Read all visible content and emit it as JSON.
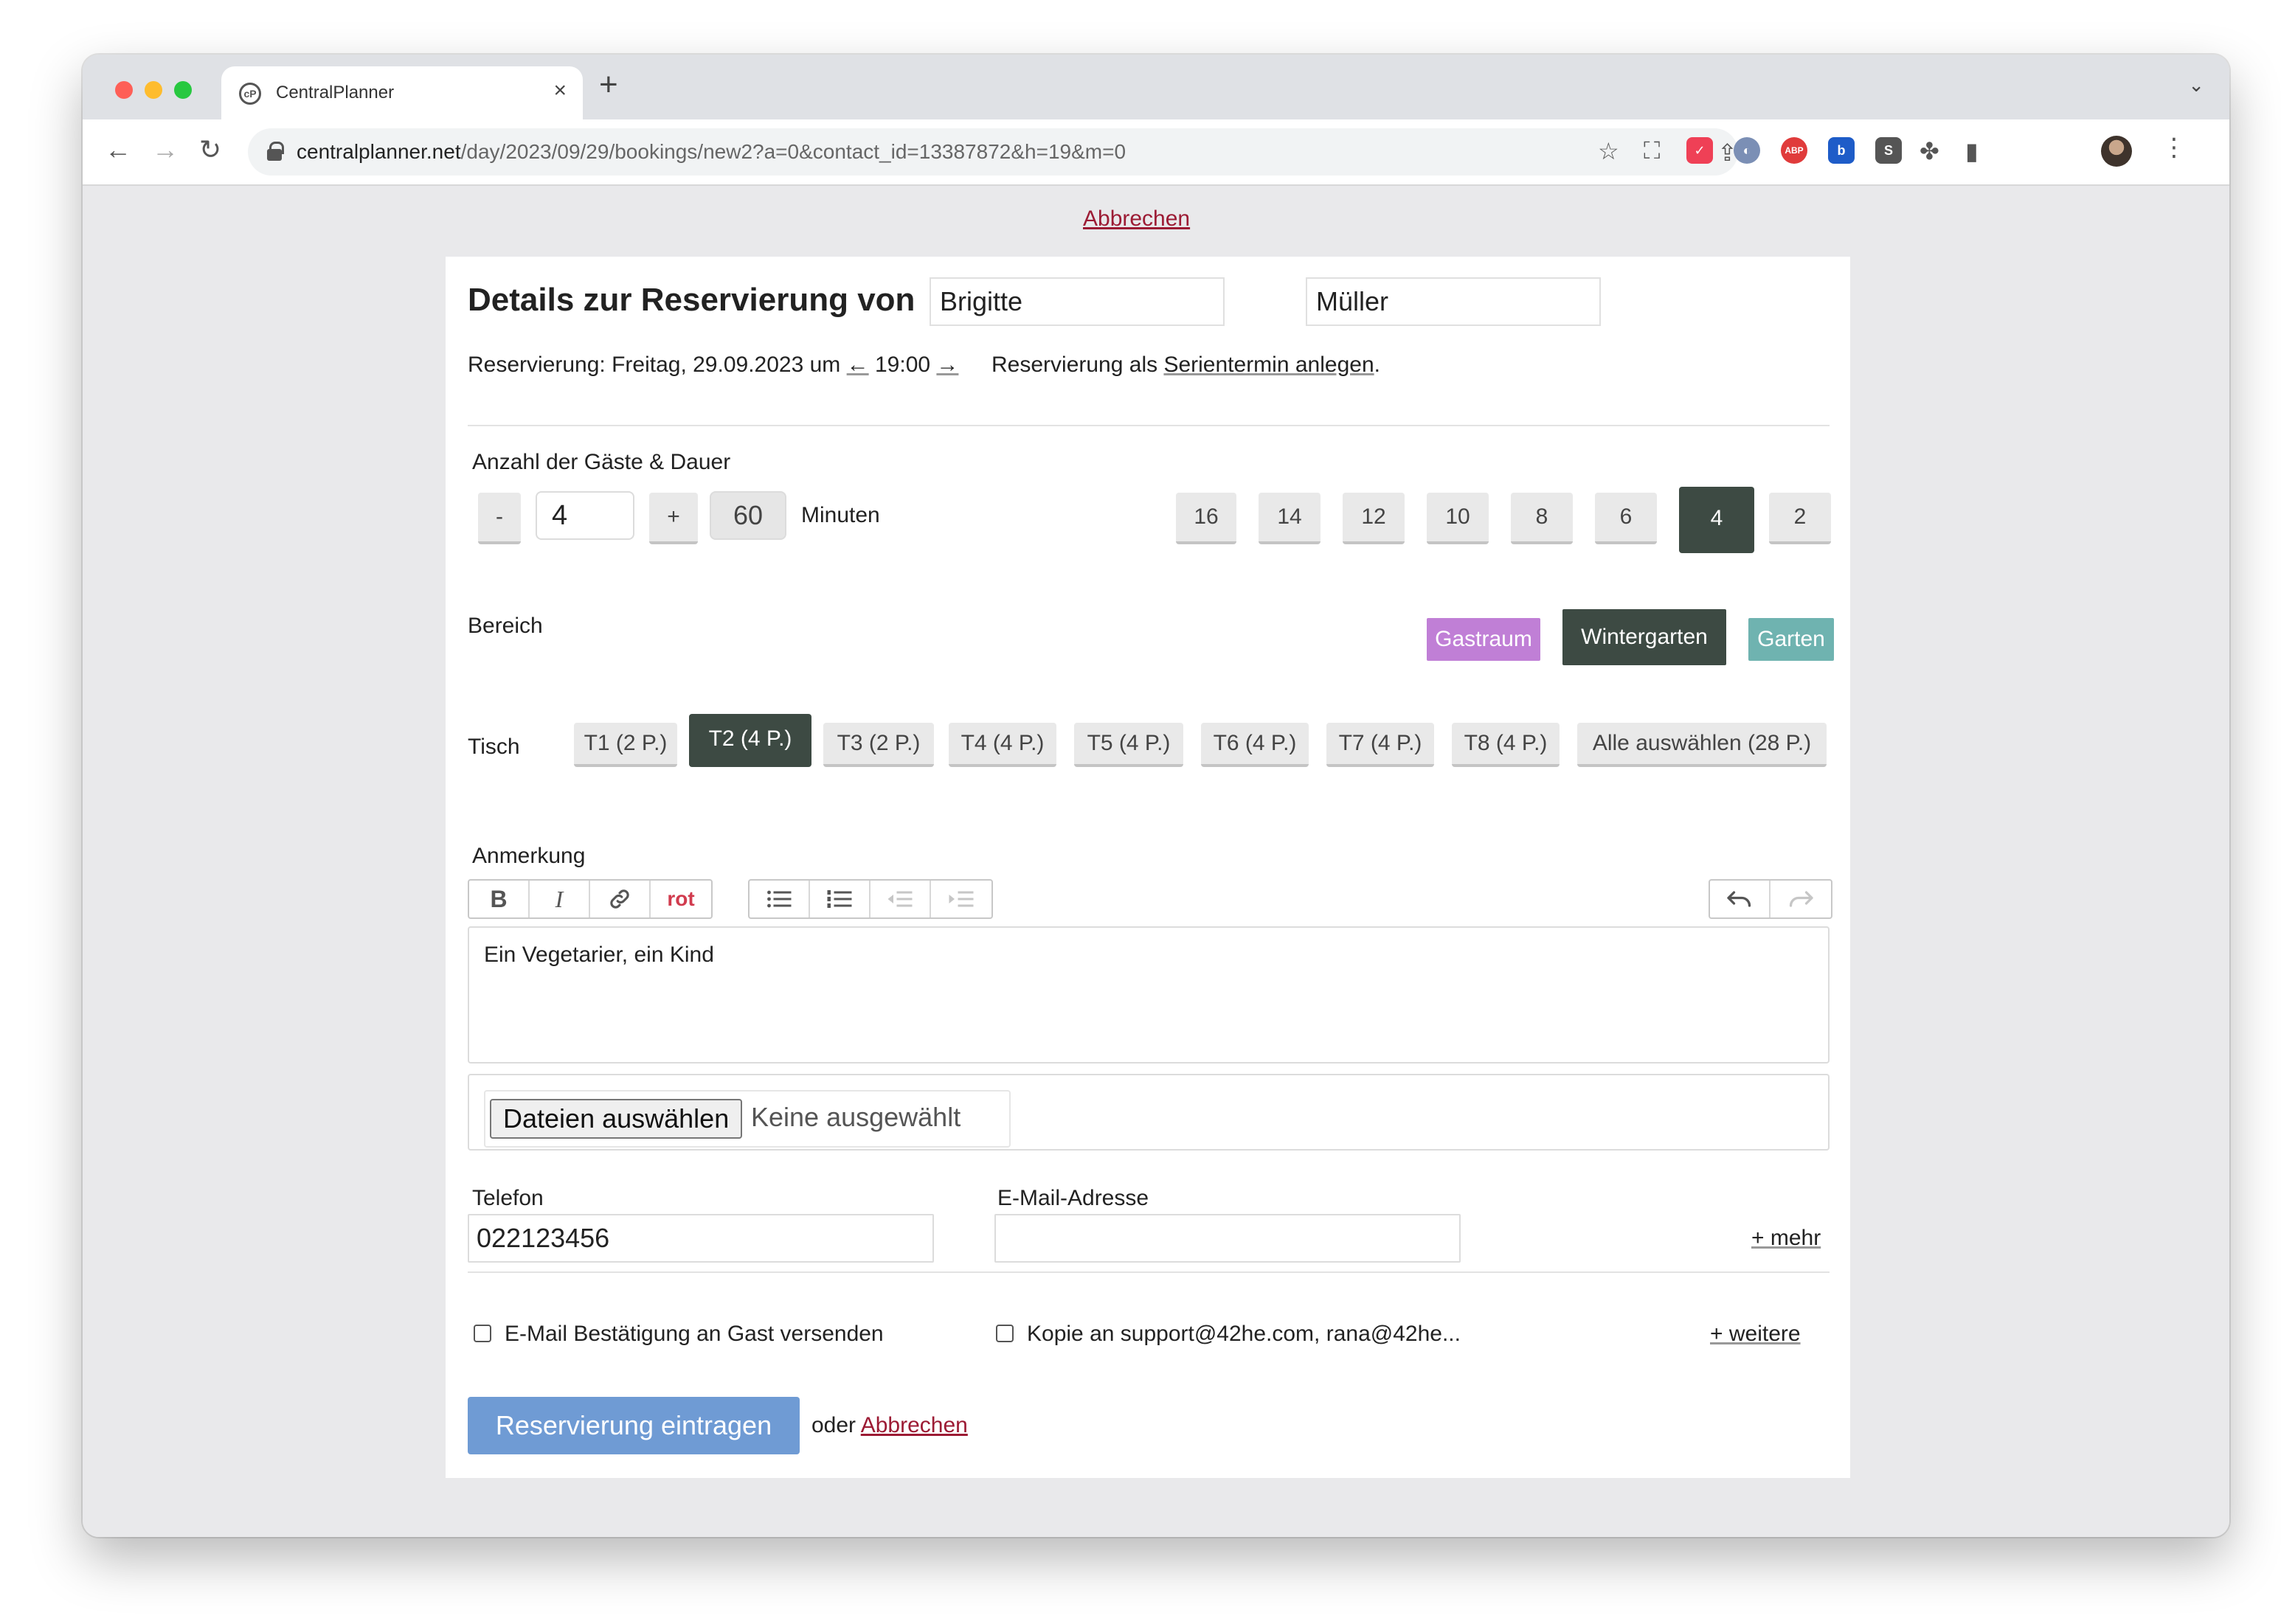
{
  "browser": {
    "tab_title": "CentralPlanner",
    "url_host": "centralplanner.net",
    "url_path": "/day/2023/09/29/bookings/new2?a=0&contact_id=13387872&h=19&m=0"
  },
  "page": {
    "top_cancel": "Abbrechen",
    "heading": "Details zur Reservierung von",
    "first_name": "Brigitte",
    "last_name": "Müller",
    "reservation_prefix": "Reservierung: Freitag, 29.09.2023 um",
    "prev_arrow": "←",
    "time": "19:00",
    "next_arrow": "→",
    "series_prefix": "Reservierung als",
    "series_link": "Serientermin anlegen",
    "series_suffix": "."
  },
  "guests": {
    "label": "Anzahl der Gäste & Dauer",
    "minus": "-",
    "count": "4",
    "plus": "+",
    "duration": "60",
    "duration_unit": "Minuten",
    "presets": [
      "16",
      "14",
      "12",
      "10",
      "8",
      "6",
      "4",
      "2"
    ],
    "selected_preset": "4"
  },
  "area": {
    "label": "Bereich",
    "options": [
      "Gastraum",
      "Wintergarten",
      "Garten"
    ],
    "selected": "Wintergarten",
    "colors": {
      "Gastraum": "#c07fd6",
      "Wintergarten": "#3d4a43",
      "Garten": "#6fb3b0"
    }
  },
  "table": {
    "label": "Tisch",
    "options": [
      "T1 (2 P.)",
      "T2 (4 P.)",
      "T3 (2 P.)",
      "T4 (4 P.)",
      "T5 (4 P.)",
      "T6 (4 P.)",
      "T7 (4 P.)",
      "T8 (4 P.)",
      "Alle auswählen (28 P.)"
    ],
    "selected": "T2 (4 P.)"
  },
  "note": {
    "label": "Anmerkung",
    "toolbar": {
      "bold": "B",
      "italic": "I",
      "red": "rot"
    },
    "text": "Ein Vegetarier, ein Kind"
  },
  "files": {
    "button": "Dateien auswählen",
    "status": "Keine ausgewählt"
  },
  "contact": {
    "phone_label": "Telefon",
    "phone": "022123456",
    "email_label": "E-Mail-Adresse",
    "email": "",
    "more": "+ mehr"
  },
  "options": {
    "email_confirm": "E-Mail Bestätigung an Gast versenden",
    "copy_to": "Kopie an support@42he.com, rana@42he...",
    "more": "+ weitere"
  },
  "actions": {
    "submit": "Reservierung eintragen",
    "or": "oder",
    "cancel": "Abbrechen"
  }
}
